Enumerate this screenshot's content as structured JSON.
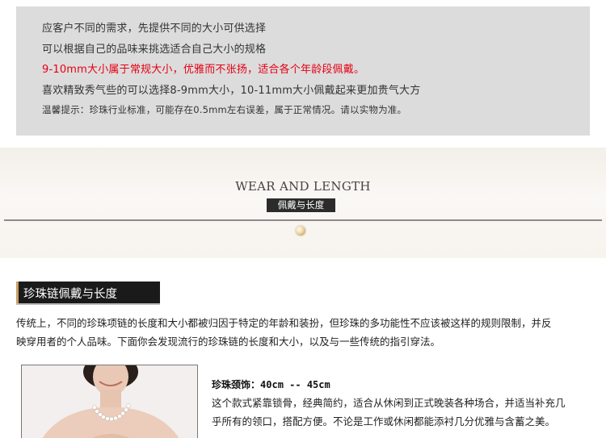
{
  "info": {
    "line1": "应客户不同的需求，先提供不同的大小可供选择",
    "line2": "可以根据自己的品味来挑选适合自己大小的规格",
    "line3": "9-10mm大小属于常规大小，优雅而不张扬，适合各个年龄段佩戴。",
    "line4": "喜欢精致秀气些的可以选择8-9mm大小，10-11mm大小佩戴起来更加贵气大方",
    "line5": "温馨提示：珍珠行业标准，可能存在0.5mm左右误差，属于正常情况。请以实物为准。"
  },
  "banner": {
    "title": "WEAR AND LENGTH",
    "subtitle": "佩戴与长度"
  },
  "section": {
    "heading": "珍珠链佩戴与长度",
    "para_line1": "传统上，不同的珍珠项链的长度和大小都被归因于特定的年龄和装扮，但珍珠的多功能性不应该被这样的规则限制，并反",
    "para_line2": "映穿用者的个人品味。下面你会发现流行的珍珠链的长度和大小，以及与一些传统的指引穿法。"
  },
  "item": {
    "name": "珍珠颈饰：",
    "length": "40cm -- 45cm",
    "desc_line1": "这个款式紧靠锁骨，经典简约，适合从休闲到正式晚装各种场合，并适当补充几",
    "desc_line2": "乎所有的领口，搭配方便。不论是工作或休闲都能添衬几分优雅与含蓄之美。"
  },
  "colors": {
    "info_bg": "#dcdcdc",
    "highlight": "#e60012",
    "heading_bg": "#1a1a1a",
    "accent_gold": "#c9a063"
  }
}
